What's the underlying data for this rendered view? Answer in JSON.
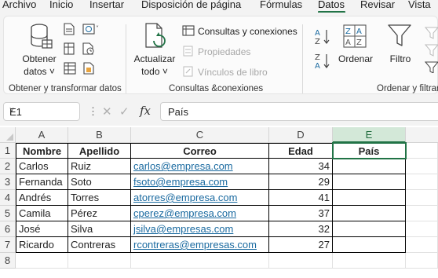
{
  "menu": {
    "tabs": [
      "Archivo",
      "Inicio",
      "Insertar",
      "Disposición de página",
      "Fórmulas",
      "Datos",
      "Revisar",
      "Vista"
    ],
    "active": "Datos"
  },
  "ribbon": {
    "groups": {
      "obtener": {
        "label": "Obtener y transformar datos",
        "obtener_datos_line1": "Obtener",
        "obtener_datos_line2": "datos",
        "chevron": "˅"
      },
      "consultas": {
        "label": "Consultas &conexiones",
        "actualizar_line1": "Actualizar",
        "actualizar_line2": "todo",
        "chevron": "˅",
        "consultas_conexiones": "Consultas y conexiones",
        "propiedades": "Propiedades",
        "vinculos": "Vínculos de libro"
      },
      "ordenar": {
        "label": "Ordenar y filtrar",
        "ordenar": "Ordenar",
        "filtro": "Filtro",
        "az": "A Z",
        "za": "Z A"
      }
    }
  },
  "formula_bar": {
    "name_box": "E1",
    "name_chevron": "˅",
    "fx": "fx",
    "cancel": "✕",
    "enter": "✓",
    "dots": "⋮",
    "formula": "País"
  },
  "grid": {
    "columns": [
      "A",
      "B",
      "C",
      "D",
      "E"
    ],
    "selected_column": "E",
    "row_numbers": [
      "1",
      "2",
      "3",
      "4",
      "5",
      "6",
      "7",
      "8"
    ],
    "header": [
      "Nombre",
      "Apellido",
      "Correo",
      "Edad",
      "País"
    ],
    "rows": [
      [
        "Carlos",
        "Ruiz",
        "carlos@empresa.com",
        "34",
        ""
      ],
      [
        "Fernanda",
        "Soto",
        "fsoto@empresa.com",
        "29",
        ""
      ],
      [
        "Andrés",
        "Torres",
        "atorres@empresa.com",
        "41",
        ""
      ],
      [
        "Camila",
        "Pérez",
        "cperez@empresa.com",
        "37",
        ""
      ],
      [
        "José",
        "Silva",
        "jsilva@empresas.com",
        "32",
        ""
      ],
      [
        "Ricardo",
        "Contreras",
        "rcontreras@empresas.com",
        "27",
        ""
      ]
    ]
  },
  "colors": {
    "accent": "#217346",
    "link": "#1a6aa0"
  }
}
